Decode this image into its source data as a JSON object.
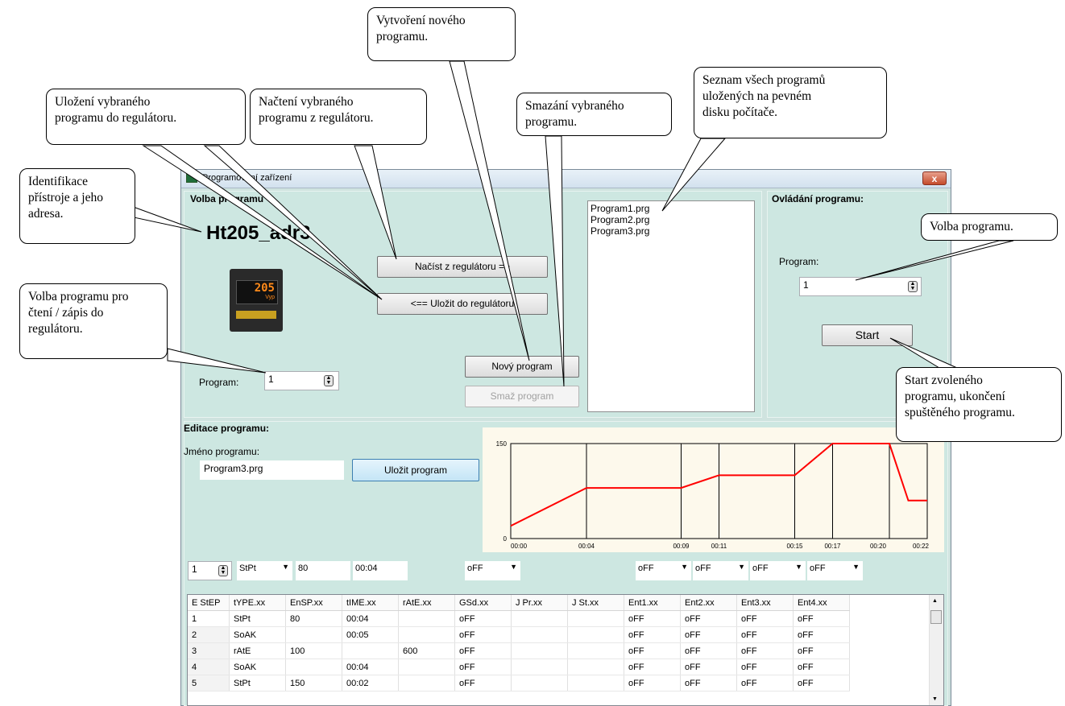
{
  "window": {
    "title": "Programování zařízení",
    "close_label": "x"
  },
  "volba": {
    "section": "Volba programu",
    "device_id": "Ht205_adr3",
    "device_display": "205",
    "device_display_sub": "Vyp",
    "btn_load": "Načíst z regulátoru =>",
    "btn_save": "<== Uložit do regulátoru",
    "btn_new": "Nový program",
    "btn_delete": "Smaž program",
    "program_label": "Program:",
    "program_value": "1",
    "files": [
      "Program1.prg",
      "Program2.prg",
      "Program3.prg"
    ]
  },
  "control": {
    "section": "Ovládání programu:",
    "program_label": "Program:",
    "program_value": "1",
    "start_label": "Start"
  },
  "editor": {
    "section": "Editace programu:",
    "name_label": "Jméno programu:",
    "name_value": "Program3.prg",
    "save_label": "Uložit program"
  },
  "chart_data": {
    "type": "line",
    "x": [
      "00:00",
      "00:04",
      "00:09",
      "00:11",
      "00:15",
      "00:17",
      "00:20",
      "00:22"
    ],
    "x_minutes": [
      0,
      4,
      9,
      11,
      15,
      17,
      20,
      22
    ],
    "series": [
      {
        "points_min": [
          0,
          4,
          9,
          11,
          15,
          17,
          20,
          21,
          22
        ],
        "values": [
          20,
          80,
          80,
          100,
          100,
          150,
          150,
          60,
          60
        ],
        "color": "#ff0000"
      }
    ],
    "ylim": [
      0,
      150
    ],
    "y_ticks": [
      "150",
      "0"
    ],
    "background": "#fdf9ec",
    "gridlines_x": [
      "00:04",
      "00:09",
      "00:11",
      "00:15",
      "00:17",
      "00:20",
      "00:22"
    ]
  },
  "editrow": {
    "step": "1",
    "type": "StPt",
    "ensp": "80",
    "time": "00:04",
    "gsd": "oFF",
    "ent1": "oFF",
    "ent2": "oFF",
    "ent3": "oFF",
    "ent4": "oFF"
  },
  "table": {
    "headers": [
      "E StEP",
      "tYPE.xx",
      "EnSP.xx",
      "tIME.xx",
      "rAtE.xx",
      "GSd.xx",
      "J Pr.xx",
      "J St.xx",
      "Ent1.xx",
      "Ent2.xx",
      "Ent3.xx",
      "Ent4.xx"
    ],
    "rows": [
      [
        "1",
        "StPt",
        "80",
        "00:04",
        "",
        "oFF",
        "",
        "",
        "oFF",
        "oFF",
        "oFF",
        "oFF"
      ],
      [
        "2",
        "SoAK",
        "",
        "00:05",
        "",
        "oFF",
        "",
        "",
        "oFF",
        "oFF",
        "oFF",
        "oFF"
      ],
      [
        "3",
        "rAtE",
        "100",
        "",
        "600",
        "oFF",
        "",
        "",
        "oFF",
        "oFF",
        "oFF",
        "oFF"
      ],
      [
        "4",
        "SoAK",
        "",
        "00:04",
        "",
        "oFF",
        "",
        "",
        "oFF",
        "oFF",
        "oFF",
        "oFF"
      ],
      [
        "5",
        "StPt",
        "150",
        "00:02",
        "",
        "oFF",
        "",
        "",
        "oFF",
        "oFF",
        "oFF",
        "oFF"
      ]
    ]
  },
  "callouts": {
    "ident": "Identifikace\npřístroje a jeho\nadresa.",
    "save": "Uložení vybraného\nprogramu do regulátoru.",
    "load": "Načtení vybraného\nprogramu z regulátoru.",
    "new": "Vytvoření nového\nprogramu.",
    "delete": "Smazání vybraného\nprogramu.",
    "list": "Seznam všech programů\nuložených na pevném\ndisku počítače.",
    "select": "Volba programu.",
    "readwrite": "Volba programu pro\nčtení / zápis do\nregulátoru.",
    "start": "Start zvoleného\nprogramu, ukončení\nspuštěného programu."
  }
}
